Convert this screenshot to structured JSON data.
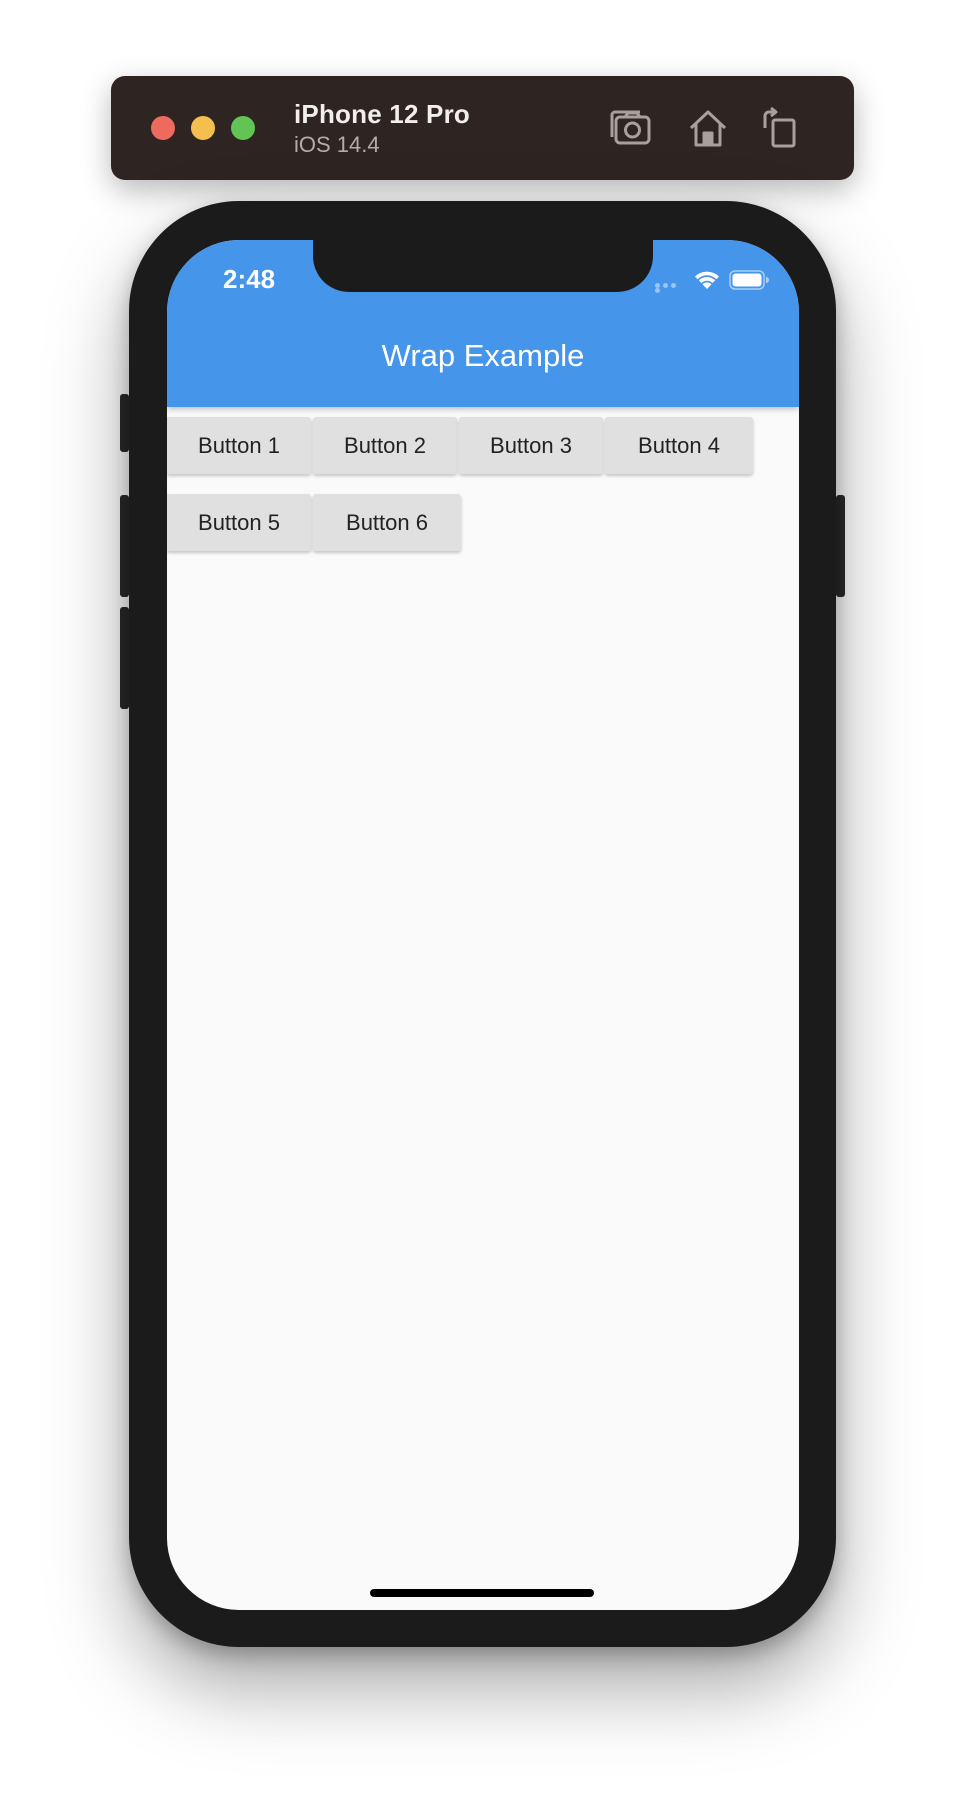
{
  "simulator": {
    "device_name": "iPhone 12 Pro",
    "os_version": "iOS 14.4",
    "tools": [
      "screenshot-icon",
      "home-icon",
      "rotate-icon"
    ]
  },
  "status_bar": {
    "time": "2:48",
    "icons": [
      "cellular-dots-icon",
      "wifi-icon",
      "battery-icon"
    ]
  },
  "app_bar": {
    "title": "Wrap Example",
    "background": "#4595eb"
  },
  "buttons": [
    {
      "label": "Button 1"
    },
    {
      "label": "Button 2"
    },
    {
      "label": "Button 3"
    },
    {
      "label": "Button 4"
    },
    {
      "label": "Button 5"
    },
    {
      "label": "Button 6"
    }
  ],
  "colors": {
    "screen_background": "#fafafa",
    "button_background": "#e0e0e0",
    "simulator_bar": "#2e2422"
  }
}
